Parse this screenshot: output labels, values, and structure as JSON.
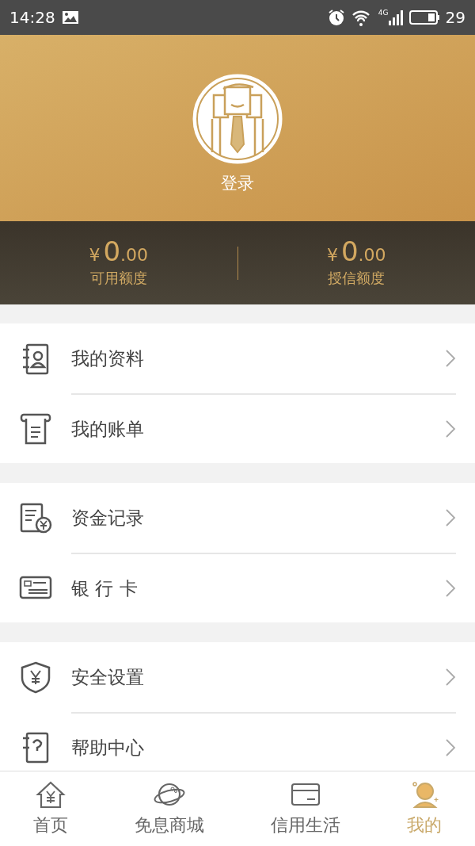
{
  "status_bar": {
    "time": "14:28",
    "network": "4G",
    "battery": "29"
  },
  "profile": {
    "login": "登录"
  },
  "balances": [
    {
      "currency": "¥",
      "integer": "0",
      "decimals": ".00",
      "label": "可用额度"
    },
    {
      "currency": "¥",
      "integer": "0",
      "decimals": ".00",
      "label": "授信额度"
    }
  ],
  "menu_groups": [
    {
      "items": [
        {
          "label": "我的资料"
        },
        {
          "label": "我的账单"
        }
      ]
    },
    {
      "items": [
        {
          "label": "资金记录"
        },
        {
          "label": "银 行 卡"
        }
      ]
    },
    {
      "items": [
        {
          "label": "安全设置"
        },
        {
          "label": "帮助中心"
        }
      ]
    }
  ],
  "tab_bar": [
    {
      "label": "首页",
      "selected": false
    },
    {
      "label": "免息商城",
      "selected": false
    },
    {
      "label": "信用生活",
      "selected": false
    },
    {
      "label": "我的",
      "selected": true
    }
  ]
}
